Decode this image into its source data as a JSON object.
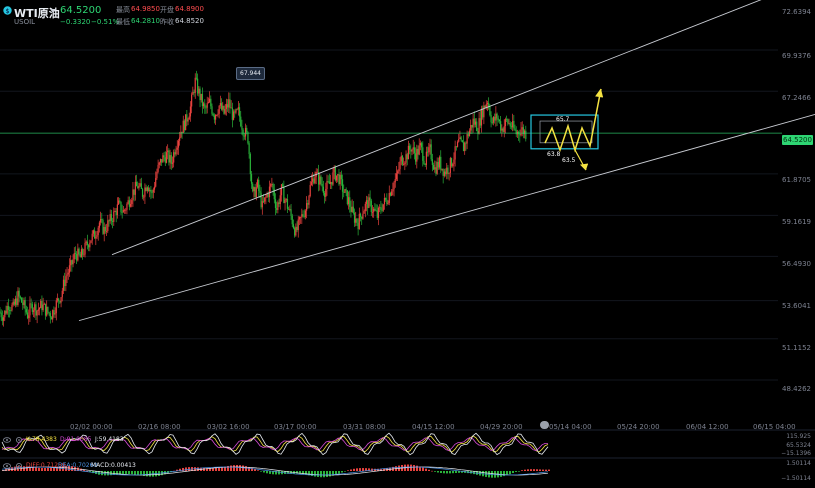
{
  "header": {
    "symbol": "WTI原油",
    "sub_symbol": "USOIL",
    "last_price": "64.5200",
    "change": "−0.3320",
    "change_pct": "−0.51%",
    "quote": [
      {
        "label": "最高",
        "value": "64.9850",
        "color": "#ff4d4f"
      },
      {
        "label": "开盘",
        "value": "64.8900",
        "color": "#ff4d4f"
      },
      {
        "label": "最低",
        "value": "64.2810",
        "color": "#2ed573"
      },
      {
        "label": "昨收",
        "value": "64.8520",
        "color": "#d0d4dc"
      }
    ]
  },
  "price_axis": {
    "labels": [
      "72.6394",
      "69.9376",
      "67.2466",
      "64.5200",
      "61.8705",
      "59.1619",
      "56.4930",
      "53.6041",
      "51.1152",
      "48.4262"
    ],
    "current_tag": "64.5200"
  },
  "time_axis": {
    "labels": [
      "02/02 00:00",
      "02/16 08:00",
      "03/02 16:00",
      "03/17 00:00",
      "03/31 08:00",
      "04/15 12:00",
      "04/29 20:00",
      "05/14 04:00",
      "05/24 20:00",
      "06/04 12:00",
      "06/15 04:00"
    ]
  },
  "annotations": {
    "peak_label": "67.944",
    "box_high": "65.7",
    "box_low_left": "63.8",
    "box_low_right": "63.5"
  },
  "indicators": {
    "kdj": {
      "labels": [
        "K:78.4383",
        "D:91.0085",
        "J:59.4183"
      ],
      "levels": [
        "115.925",
        "65.5324",
        "−15.1396"
      ]
    },
    "macd": {
      "labels": [
        "DIFF:0.71259",
        "DEA:0.70260",
        "MACD:0.00413"
      ],
      "levels": [
        "1.50114",
        "−1.50114"
      ]
    }
  },
  "colors": {
    "up": "#e8423e",
    "down": "#2ab33a",
    "channel": "#c8cbd2",
    "price_line": "#2ed573",
    "highlight": "#f5e342",
    "box": "#25c7e0"
  },
  "chart_data": {
    "type": "candlestick",
    "x_labels": [
      "02/02 00:00",
      "02/16 08:00",
      "03/02 16:00",
      "03/17 00:00",
      "03/31 08:00",
      "04/15 12:00",
      "04/29 20:00",
      "05/14 04:00",
      "05/24 20:00",
      "06/04 12:00",
      "06/15 04:00"
    ],
    "ylim": [
      46.8,
      73.2
    ],
    "last_price": 64.52,
    "trend_closes": [
      52.9,
      52.6,
      53.4,
      53.1,
      53.9,
      53.4,
      52.7,
      53.3,
      53.0,
      53.3,
      52.9,
      52.7,
      53.4,
      54.0,
      55.2,
      55.8,
      56.7,
      56.4,
      57.0,
      57.6,
      57.9,
      58.7,
      58.2,
      58.7,
      59.2,
      59.8,
      59.4,
      60.0,
      60.7,
      61.1,
      60.6,
      61.3,
      60.5,
      62.0,
      62.8,
      63.1,
      62.6,
      63.8,
      64.7,
      65.3,
      66.2,
      67.9,
      66.9,
      66.0,
      66.5,
      65.7,
      66.3,
      65.8,
      66.5,
      65.5,
      65.9,
      64.8,
      64.2,
      60.4,
      61.1,
      59.7,
      60.5,
      61.2,
      59.6,
      60.8,
      60.0,
      59.1,
      58.0,
      58.9,
      59.6,
      61.0,
      61.9,
      61.4,
      60.8,
      61.2,
      61.9,
      61.6,
      60.7,
      60.1,
      59.1,
      58.7,
      59.5,
      60.0,
      59.6,
      59.1,
      59.8,
      60.2,
      61.0,
      61.6,
      62.8,
      63.0,
      63.6,
      63.1,
      63.6,
      62.7,
      63.4,
      62.2,
      62.6,
      62.0,
      62.3,
      63.0,
      63.9,
      63.6,
      64.5,
      65.3,
      64.9,
      66.0,
      66.7,
      65.2,
      65.6,
      64.8,
      65.3,
      65.0,
      64.5,
      64.8,
      64.52
    ],
    "channel": {
      "upper": [
        {
          "x": "02/16 08:00",
          "y": 56.6
        },
        {
          "x": "06/15 04:00",
          "y": 73.5
        }
      ],
      "lower": [
        {
          "x": "02/02 00:00",
          "y": 52.3
        },
        {
          "x": "06/15 04:00",
          "y": 66.0
        }
      ]
    },
    "projection_box": {
      "high": 65.7,
      "low": 63.5
    }
  }
}
